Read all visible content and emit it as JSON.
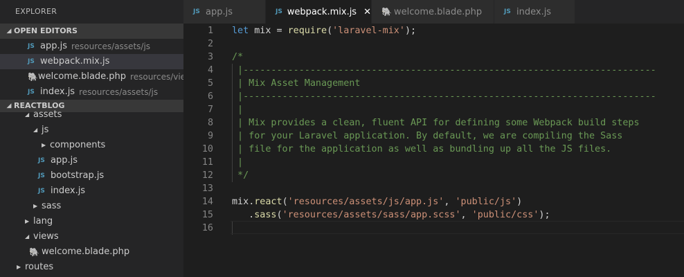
{
  "sidebar": {
    "title": "EXPLORER",
    "open_editors": {
      "label": "OPEN EDITORS",
      "items": [
        {
          "name": "app.js",
          "desc": "resources/assets/js",
          "icon": "JS"
        },
        {
          "name": "webpack.mix.js",
          "desc": "",
          "icon": "JS"
        },
        {
          "name": "welcome.blade.php",
          "desc": "resources/vie...",
          "icon": "php"
        },
        {
          "name": "index.js",
          "desc": "resources/assets/js",
          "icon": "JS"
        }
      ]
    },
    "project": {
      "label": "REACTBLOG",
      "tree": {
        "assets": "assets",
        "js": "js",
        "components": "components",
        "app_js": "app.js",
        "bootstrap_js": "bootstrap.js",
        "index_js": "index.js",
        "sass": "sass",
        "lang": "lang",
        "views": "views",
        "welcome": "welcome.blade.php",
        "routes": "routes"
      }
    }
  },
  "tabs": [
    {
      "label": "app.js",
      "icon": "JS",
      "active": false
    },
    {
      "label": "webpack.mix.js",
      "icon": "JS",
      "active": true,
      "close": "✕"
    },
    {
      "label": "welcome.blade.php",
      "icon": "php",
      "active": false
    },
    {
      "label": "index.js",
      "icon": "JS",
      "active": false
    }
  ],
  "editor": {
    "line_numbers": [
      "1",
      "2",
      "3",
      "4",
      "5",
      "6",
      "7",
      "8",
      "9",
      "10",
      "11",
      "12",
      "13",
      "14",
      "15",
      "16"
    ],
    "lines": [
      [
        {
          "t": "let",
          "c": "kw"
        },
        {
          "t": " mix = ",
          "c": "pl"
        },
        {
          "t": "require",
          "c": "fn"
        },
        {
          "t": "(",
          "c": "pl"
        },
        {
          "t": "'laravel-mix'",
          "c": "str"
        },
        {
          "t": ");",
          "c": "pl"
        }
      ],
      [],
      [
        {
          "t": "/*",
          "c": "cmt"
        }
      ],
      [
        {
          "t": " |--------------------------------------------------------------------------",
          "c": "cmt"
        }
      ],
      [
        {
          "t": " | Mix Asset Management",
          "c": "cmt"
        }
      ],
      [
        {
          "t": " |--------------------------------------------------------------------------",
          "c": "cmt"
        }
      ],
      [
        {
          "t": " |",
          "c": "cmt"
        }
      ],
      [
        {
          "t": " | Mix provides a clean, fluent API for defining some Webpack build steps",
          "c": "cmt"
        }
      ],
      [
        {
          "t": " | for your Laravel application. By default, we are compiling the Sass",
          "c": "cmt"
        }
      ],
      [
        {
          "t": " | file for the application as well as bundling up all the JS files.",
          "c": "cmt"
        }
      ],
      [
        {
          "t": " |",
          "c": "cmt"
        }
      ],
      [
        {
          "t": " */",
          "c": "cmt"
        }
      ],
      [],
      [
        {
          "t": "mix",
          "c": "pl"
        },
        {
          "t": ".",
          "c": "pl"
        },
        {
          "t": "react",
          "c": "fn"
        },
        {
          "t": "(",
          "c": "pl"
        },
        {
          "t": "'resources/assets/js/app.js'",
          "c": "str"
        },
        {
          "t": ", ",
          "c": "pl"
        },
        {
          "t": "'public/js'",
          "c": "str"
        },
        {
          "t": ")",
          "c": "pl"
        }
      ],
      [
        {
          "t": "   .",
          "c": "pl"
        },
        {
          "t": "sass",
          "c": "fn"
        },
        {
          "t": "(",
          "c": "pl"
        },
        {
          "t": "'resources/assets/sass/app.scss'",
          "c": "str"
        },
        {
          "t": ", ",
          "c": "pl"
        },
        {
          "t": "'public/css'",
          "c": "str"
        },
        {
          "t": ");",
          "c": "pl"
        }
      ],
      []
    ]
  }
}
